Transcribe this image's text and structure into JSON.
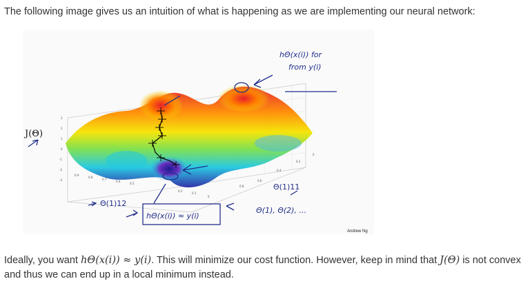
{
  "intro_text": "The following image gives us an intuition of what is happening as we are implementing our neural network:",
  "figure": {
    "credit": "Andrew Ng",
    "j_label": "J(Θ)",
    "annotations": {
      "top_right_line1": "hΘ(x(i)) for",
      "top_right_line2": "from y(i)",
      "theta11": "Θ(1)11",
      "theta12": "Θ(1)12",
      "bottom_box": "hΘ(x(i)) ≈ y(i)",
      "bottom_right": "Θ(1), Θ(2), ..."
    },
    "colors": {
      "surface_high": "#e8202a",
      "surface_mid": "#f5e400",
      "surface_low": "#20c8e0",
      "surface_min": "#2a2aa8",
      "ink": "#1f2d8a"
    }
  },
  "outro": {
    "part1": "Ideally, you want ",
    "math1": "hΘ(x(i)) ≈ y(i)",
    "part2": ". This will minimize our cost function. However, keep in mind that ",
    "math2": "J(Θ)",
    "part3": " is not convex and thus we can end up in a local minimum instead."
  }
}
